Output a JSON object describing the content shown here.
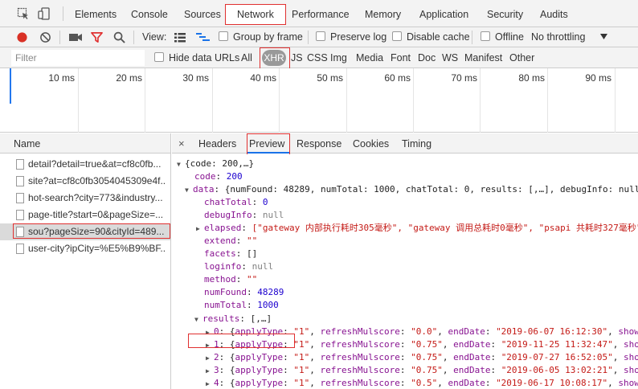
{
  "tabs": {
    "elements": "Elements",
    "console": "Console",
    "sources": "Sources",
    "network": "Network",
    "performance": "Performance",
    "memory": "Memory",
    "application": "Application",
    "security": "Security",
    "audits": "Audits"
  },
  "toolbar": {
    "view_label": "View:",
    "group_by_frame": "Group by frame",
    "preserve_log": "Preserve log",
    "disable_cache": "Disable cache",
    "offline": "Offline",
    "throttling": "No throttling"
  },
  "filter": {
    "placeholder": "Filter",
    "hide_data_urls": "Hide data URLs",
    "types": [
      "All",
      "XHR",
      "JS",
      "CSS",
      "Img",
      "Media",
      "Font",
      "Doc",
      "WS",
      "Manifest",
      "Other"
    ]
  },
  "timeline": {
    "ticks": [
      "10 ms",
      "20 ms",
      "30 ms",
      "40 ms",
      "50 ms",
      "60 ms",
      "70 ms",
      "80 ms",
      "90 ms"
    ]
  },
  "requests": {
    "header": "Name",
    "items": [
      "detail?detail=true&at=cf8c0fb...",
      "site?at=cf8c0fb3054045309e4f...",
      "hot-search?city=773&industry...",
      "page-title?start=0&pageSize=...",
      "sou?pageSize=90&cityId=489...",
      "user-city?ipCity=%E5%B9%BF..."
    ],
    "selected_index": 4
  },
  "detail_tabs": {
    "close": "×",
    "headers": "Headers",
    "preview": "Preview",
    "response": "Response",
    "cookies": "Cookies",
    "timing": "Timing",
    "active": "Preview"
  },
  "json_preview": {
    "root": "{code: 200,…}",
    "code_key": "code",
    "code_val": "200",
    "data_key": "data",
    "data_summary": "{numFound: 48289, numTotal: 1000, chatTotal: 0, results: [,…], debugInfo: null,…}",
    "chatTotal_key": "chatTotal",
    "chatTotal_val": "0",
    "debugInfo_key": "debugInfo",
    "debugInfo_val": "null",
    "elapsed_key": "elapsed",
    "elapsed_val": "[\"gateway 内部执行耗时305毫秒\", \"gateway 调用总耗时0毫秒\", \"psapi 共耗时327毫秒\"]",
    "extend_key": "extend",
    "extend_val": "\"\"",
    "facets_key": "facets",
    "facets_val": "[]",
    "loginfo_key": "loginfo",
    "loginfo_val": "null",
    "method_key": "method",
    "method_val": "\"\"",
    "numFound_key": "numFound",
    "numFound_val": "48289",
    "numTotal_key": "numTotal",
    "numTotal_val": "1000",
    "results_key": "results",
    "results_val": "[,…]",
    "results_items": [
      {
        "idx": "0",
        "applyType": "\"1\"",
        "refreshMulscore": "\"0.0\"",
        "endDate": "\"2019-06-07 16:12:30\""
      },
      {
        "idx": "1",
        "applyType": "\"1\"",
        "refreshMulscore": "\"0.75\"",
        "endDate": "\"2019-11-25 11:32:47\""
      },
      {
        "idx": "2",
        "applyType": "\"1\"",
        "refreshMulscore": "\"0.75\"",
        "endDate": "\"2019-07-27 16:52:05\""
      },
      {
        "idx": "3",
        "applyType": "\"1\"",
        "refreshMulscore": "\"0.75\"",
        "endDate": "\"2019-06-05 13:02:21\""
      },
      {
        "idx": "4",
        "applyType": "\"1\"",
        "refreshMulscore": "\"0.5\"",
        "endDate": "\"2019-06-17 10:08:17\""
      }
    ],
    "trailing_key": "show"
  },
  "colors": {
    "highlight_box": "#e03030",
    "record_red": "#d93025",
    "filter_red": "#e03030",
    "active_blue": "#1a73e8",
    "json_key": "#881391",
    "json_string": "#c41a16",
    "json_number": "#1c00cf"
  },
  "icons": [
    "inspect-element-icon",
    "device-toolbar-icon",
    "record-icon",
    "clear-icon",
    "capture-screenshots-icon",
    "filter-icon",
    "search-icon",
    "large-rows-icon",
    "waterfall-icon",
    "throttle-dropdown-icon",
    "file-icon",
    "close-icon",
    "expand-triangle-icon"
  ]
}
